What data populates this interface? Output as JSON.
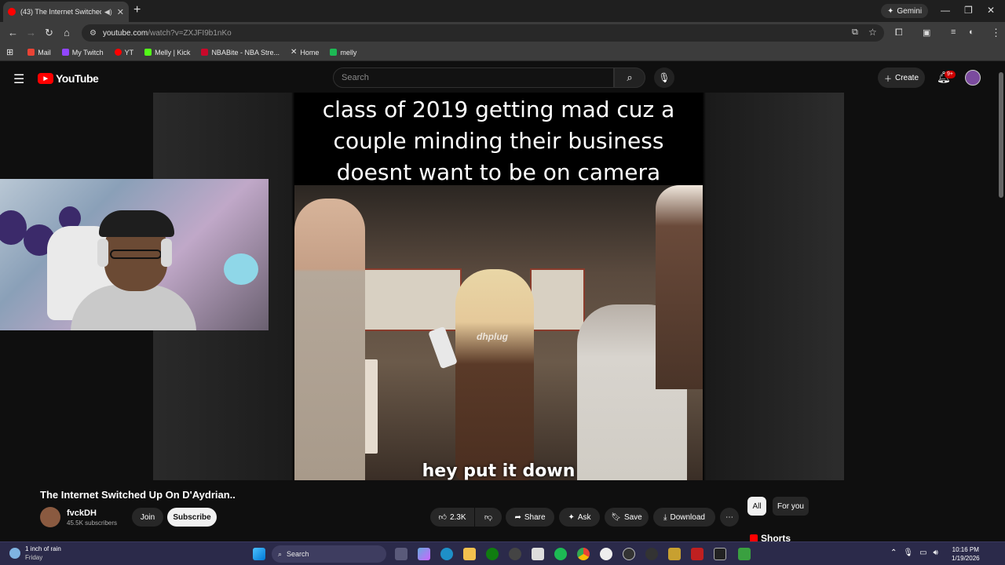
{
  "browser": {
    "tab_title": "(43) The Internet Switched",
    "url_host": "youtube.com",
    "url_path": "/watch?v=ZXJFI9b1nKo",
    "gemini_label": "Gemini",
    "bookmarks": [
      {
        "label": "Mail",
        "color": "#ea4335"
      },
      {
        "label": "My Twitch",
        "color": "#9146ff"
      },
      {
        "label": "YT",
        "color": "#ff0000"
      },
      {
        "label": "Melly | Kick",
        "color": "#53fc18"
      },
      {
        "label": "NBABite - NBA Stre...",
        "color": "#c9082a"
      },
      {
        "label": "Home",
        "color": "#ffffff"
      },
      {
        "label": "melly",
        "color": "#1db954"
      }
    ]
  },
  "youtube": {
    "logo_text": "YouTube",
    "search_placeholder": "Search",
    "create_label": "Create",
    "notification_badge": "9+"
  },
  "video": {
    "caption": "class of 2019 getting mad cuz a couple minding their business doesnt want to be on camera",
    "watermark": "dhplug",
    "subtitle": "hey put it down",
    "title": "The Internet Switched Up On D'Aydrian..",
    "channel_name": "fvckDH",
    "subscribers": "45.5K subscribers",
    "join_label": "Join",
    "subscribe_label": "Subscribe",
    "likes": "2.3K",
    "share_label": "Share",
    "ask_label": "Ask",
    "save_label": "Save",
    "download_label": "Download"
  },
  "sidebar": {
    "chips": [
      "All",
      "For you"
    ],
    "shorts_label": "Shorts"
  },
  "taskbar": {
    "weather_line1": "1 inch of rain",
    "weather_line2": "Friday",
    "search_label": "Search",
    "time": "10:16 PM",
    "date": "1/19/2026"
  }
}
